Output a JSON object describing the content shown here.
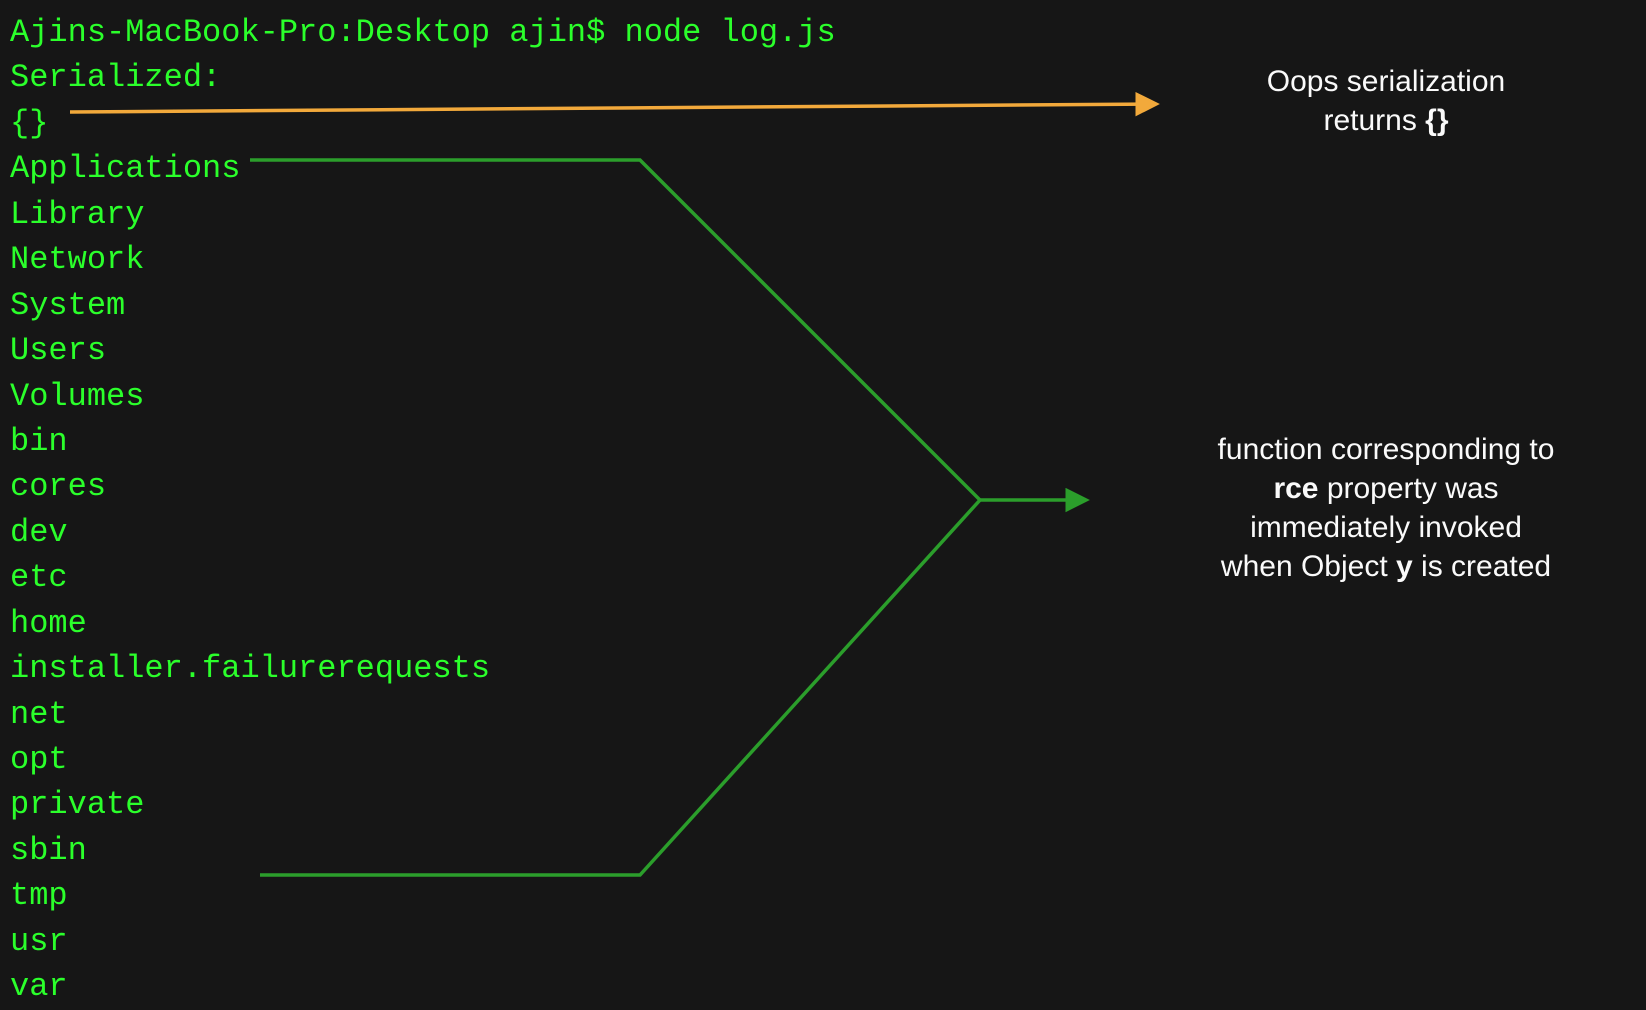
{
  "terminal": {
    "prompt": "Ajins-MacBook-Pro:Desktop ajin$ node log.js",
    "serialized_label": "Serialized:",
    "serialized_value": "{}",
    "output_lines": [
      "Applications",
      "Library",
      "Network",
      "System",
      "Users",
      "Volumes",
      "bin",
      "cores",
      "dev",
      "etc",
      "home",
      "installer.failurerequests",
      "net",
      "opt",
      "private",
      "sbin",
      "tmp",
      "usr",
      "var"
    ]
  },
  "annotations": {
    "top": {
      "line1": "Oops  serialization",
      "line2": "returns ",
      "braces": "{}"
    },
    "mid": {
      "line1": "function corresponding to",
      "line2a": "rce",
      "line2b": " property was",
      "line3": "immediately invoked",
      "line4a": "when Object ",
      "line4b": "y",
      "line4c": " is created"
    }
  },
  "colors": {
    "terminal_green": "#2bff2b",
    "arrow_orange": "#f2a93b",
    "arrow_green": "#2b9e2b",
    "text_white": "#fafafa",
    "bg": "#161616"
  }
}
